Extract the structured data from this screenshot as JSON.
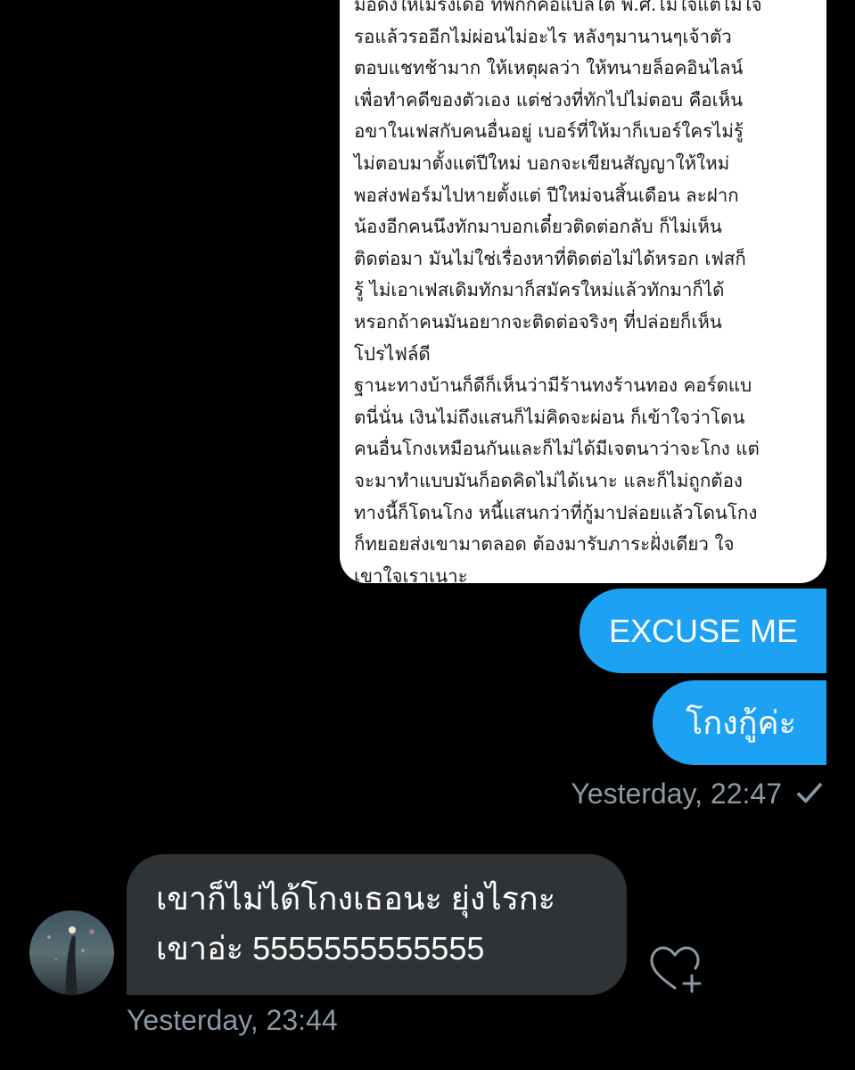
{
  "quoted_image": {
    "lines": [
      "มือดิ่งให้เมรังเดือ ที่พักก็คือแบลใต้ พ.ศ.ไม่ใจแต่ไม่ใจ",
      "รอแล้วรออีกไม่ผ่อนไม่อะไร หลังๆมานานๆเจ้าตัว",
      "ตอบแชทช้ามาก ให้เหตุผลว่า ให้ทนายล็อคอินไลน์",
      "เพื่อทำคดีของตัวเอง แต่ช่วงที่ทักไปไม่ตอบ คือเห็น",
      "อขาในเฟสกับคนอื่นอยู่ เบอร์ที่ให้มาก็เบอร์ใครไม่รู้",
      "ไม่ตอบมาตั้งแต่ปีใหม่ บอกจะเขียนสัญญาให้ใหม่",
      "พอส่งฟอร์มไปหายตั้งแต่ ปีใหม่จนสิ้นเดือน ละฝาก",
      "น้องอีกคนนึงทักมาบอกเดี๋ยวติดต่อกลับ ก็ไม่เห็น",
      "ติดต่อมา มันไม่ใช่เรื่องหาที่ติดต่อไม่ได้หรอก เฟสก็",
      "รู้ ไม่เอาเฟสเดิมทักมาก็สมัครใหม่แล้วทักมาก็ได้",
      "หรอกถ้าคนมันอยากจะติดต่อจริงๆ ที่ปล่อยก็เห็น",
      "โปรไฟล์ดี",
      "ฐานะทางบ้านก็ดีก็เห็นว่ามีร้านทงร้านทอง คอร์ดแบ",
      "ตนี่นั่น เงินไม่ถึงแสนก็ไม่คิดจะผ่อน ก็เข้าใจว่าโดน",
      "คนอื่นโกงเหมือนกันและก็ไม่ได้มีเจตนาว่าจะโกง แต่",
      "จะมาทำแบบมันก็อดคิดไม่ได้เนาะ และก็ไม่ถูกต้อง",
      "ทางนี้ก็โดนโกง หนี้แสนกว่าที่กู้มาปล่อยแล้วโดนโกง",
      "ก็ทยอยส่งเขามาตลอด ต้องมารับภาระฝั่งเดียว ใจ",
      "เขาใจเราเนาะ"
    ]
  },
  "sent_messages": [
    {
      "text": "EXCUSE ME"
    },
    {
      "text": "โกงกู้ค่ะ"
    }
  ],
  "sent_meta": {
    "timestamp": "Yesterday, 22:47",
    "status_icon": "check-icon"
  },
  "received_message": {
    "lines": [
      "เขาก็ไม่ได้โกงเธอนะ ยุ่งไรกะ",
      "เขาอ่ะ 5555555555555"
    ],
    "timestamp": "Yesterday, 23:44",
    "avatar_icon": "avatar-image",
    "like_icon": "heart-plus-icon"
  },
  "colors": {
    "background": "#000000",
    "sent_bubble": "#1da1f2",
    "received_bubble": "#2f3336",
    "meta_text": "#8b98a5"
  }
}
